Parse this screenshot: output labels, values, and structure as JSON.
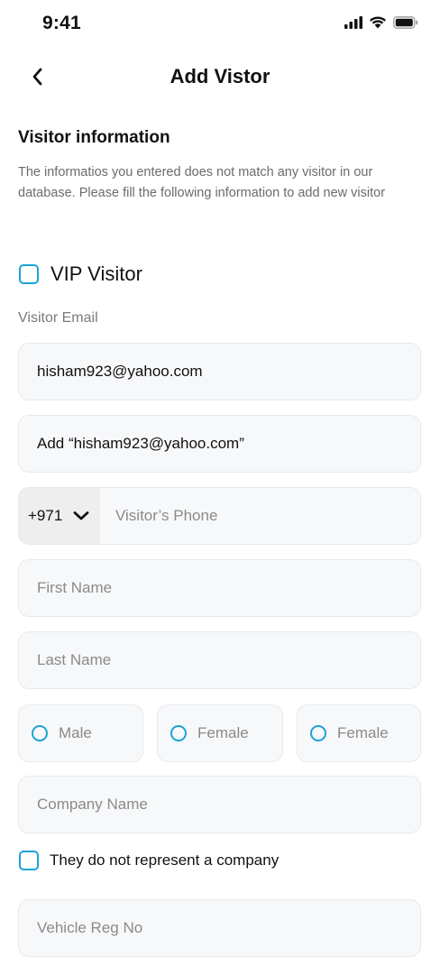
{
  "status_bar": {
    "time": "9:41"
  },
  "nav": {
    "title": "Add Vistor"
  },
  "section": {
    "title": "Visitor information",
    "description": "The informatios you entered does not match any visitor in our database. Please fill the following information to add new visitor"
  },
  "vip": {
    "label": "VIP Visitor",
    "checked": false
  },
  "email": {
    "label": "Visitor Email",
    "value": "hisham923@yahoo.com",
    "suggestion": "Add “hisham923@yahoo.com”"
  },
  "phone": {
    "country_code": "+971",
    "placeholder": "Visitor’s Phone"
  },
  "first_name": {
    "placeholder": "First Name"
  },
  "last_name": {
    "placeholder": "Last Name"
  },
  "gender": {
    "options": [
      "Male",
      "Female",
      "Female"
    ]
  },
  "company": {
    "placeholder": "Company Name",
    "no_company_label": "They do not represent a company"
  },
  "vehicle": {
    "placeholder": "Vehicle Reg No"
  },
  "colors": {
    "accent": "#1aa3d6",
    "field_bg": "#f7f8fa",
    "muted_text": "#8a8a8a"
  }
}
